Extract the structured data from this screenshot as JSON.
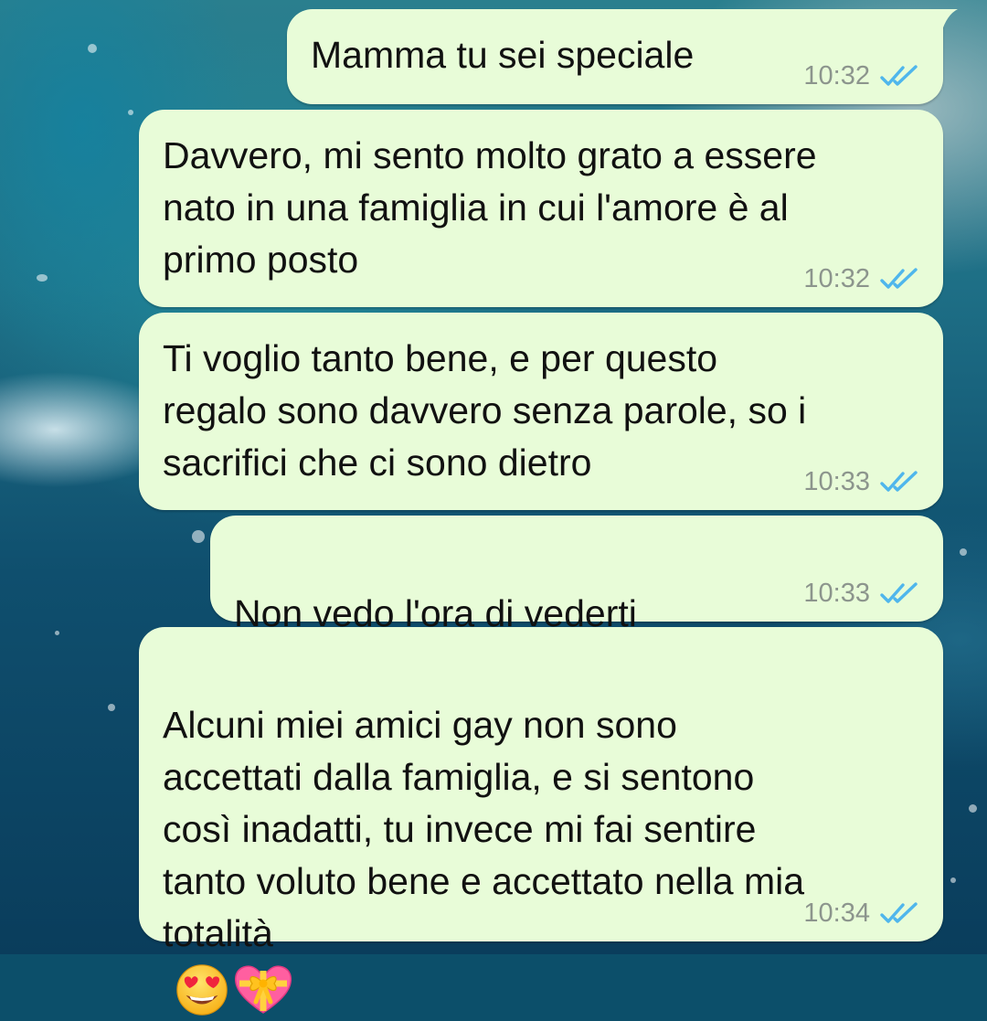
{
  "chat": {
    "messages": [
      {
        "text": "Mamma tu sei speciale",
        "time": "10:32",
        "status": "read"
      },
      {
        "text": "Davvero, mi sento molto grato a essere\nnato in una famiglia in cui l'amore è al\nprimo posto",
        "time": "10:32",
        "status": "read"
      },
      {
        "text": "Ti voglio tanto bene, e per questo\nregalo sono davvero senza parole, so i\nsacrifici che ci sono dietro",
        "time": "10:33",
        "status": "read"
      },
      {
        "text": "Non vedo l'ora di vederti",
        "emoji": [
          "heart-with-ribbon"
        ],
        "time": "10:33",
        "status": "read"
      },
      {
        "text": "Alcuni miei amici gay non sono\naccettati dalla famiglia, e si sentono\ncosì inadatti, tu invece mi fai sentire\ntanto voluto bene e accettato nella mia\ntotalità",
        "emoji": [
          "smiling-face-with-heart-eyes",
          "heart-with-ribbon"
        ],
        "time": "10:34",
        "status": "read"
      }
    ]
  },
  "colors": {
    "bubble_outgoing": "#e8fcd8",
    "read_tick": "#4fb6ec",
    "time_text": "#8c958d"
  }
}
